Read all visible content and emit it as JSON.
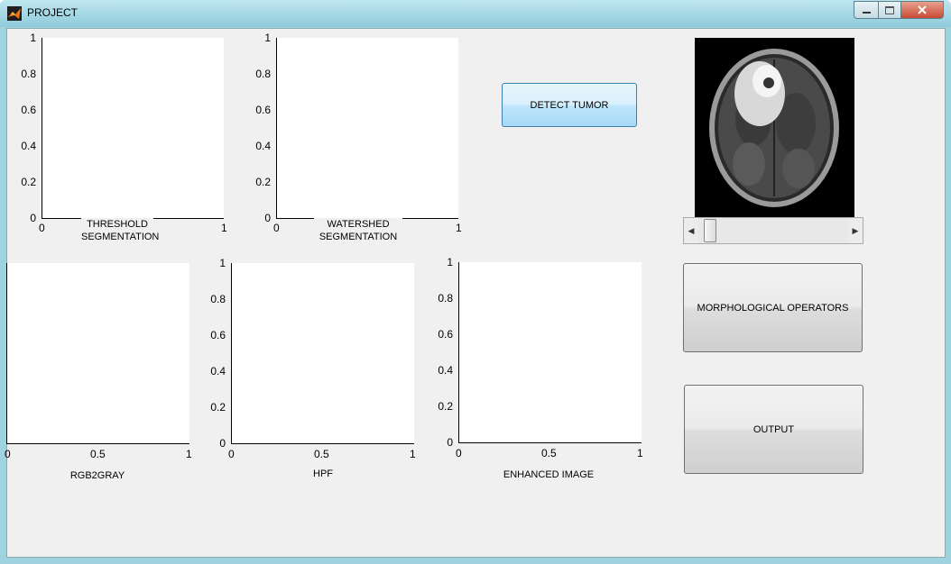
{
  "window": {
    "title": "PROJECT",
    "icon": "matlab-icon"
  },
  "window_buttons": {
    "minimize": "minimize-icon",
    "maximize": "maximize-icon",
    "close": "close-icon"
  },
  "axes": {
    "threshold": {
      "caption_line1": "THRESHOLD",
      "caption_line2": "SEGMENTATION",
      "yticks": [
        "1",
        "0.8",
        "0.6",
        "0.4",
        "0.2",
        "0"
      ],
      "xticks": [
        "0",
        "1"
      ]
    },
    "watershed": {
      "caption_line1": "WATERSHED",
      "caption_line2": "SEGMENTATION",
      "yticks": [
        "1",
        "0.8",
        "0.6",
        "0.4",
        "0.2",
        "0"
      ],
      "xticks": [
        "0",
        "1"
      ]
    },
    "rgb2gray": {
      "caption": "RGB2GRAY",
      "xticks": [
        "0",
        "0.5",
        "1"
      ]
    },
    "hpf": {
      "caption": "HPF",
      "yticks": [
        "1",
        "0.8",
        "0.6",
        "0.4",
        "0.2",
        "0"
      ],
      "xticks": [
        "0",
        "0.5",
        "1"
      ]
    },
    "enhanced": {
      "caption": "ENHANCED IMAGE",
      "yticks": [
        "1",
        "0.8",
        "0.6",
        "0.4",
        "0.2",
        "0"
      ],
      "xticks": [
        "0",
        "0.5",
        "1"
      ]
    }
  },
  "buttons": {
    "detect_tumor": "DETECT TUMOR",
    "morphological": "MORPHOLOGICAL OPERATORS",
    "output": "OUTPUT"
  },
  "image": {
    "description": "brain-mri-scan"
  },
  "slider": {
    "value_fraction": 0.1,
    "left_arrow": "◀",
    "right_arrow": "▶"
  }
}
